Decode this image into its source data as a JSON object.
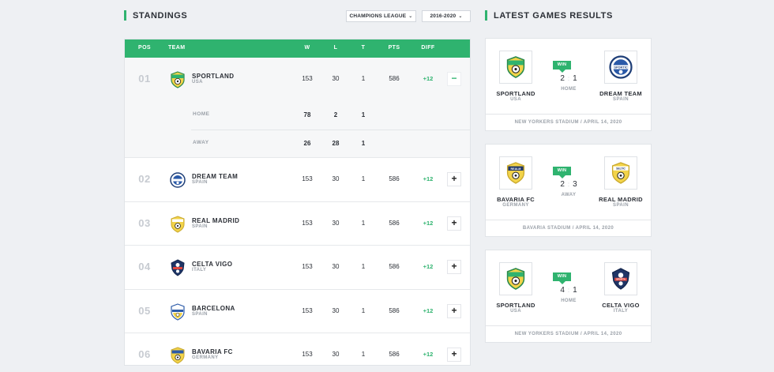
{
  "standings": {
    "title": "STANDINGS",
    "league_select": "CHAMPIONS LEAGUE",
    "season_select": "2016-2020",
    "headers": {
      "pos": "POS",
      "team": "TEAM",
      "w": "W",
      "l": "L",
      "t": "T",
      "pts": "PTS",
      "diff": "DIFF"
    },
    "rows": [
      {
        "pos": "01",
        "team": "SPORTLAND",
        "country": "USA",
        "w": "153",
        "l": "30",
        "t": "1",
        "pts": "586",
        "diff": "+12",
        "toggle": "−",
        "logo": "shield-green",
        "home": {
          "label": "HOME",
          "w": "78",
          "l": "2",
          "t": "1"
        },
        "away": {
          "label": "AWAY",
          "w": "26",
          "l": "28",
          "t": "1"
        }
      },
      {
        "pos": "02",
        "team": "DREAM TEAM",
        "country": "SPAIN",
        "w": "153",
        "l": "30",
        "t": "1",
        "pts": "586",
        "diff": "+12",
        "toggle": "+",
        "logo": "round-blue"
      },
      {
        "pos": "03",
        "team": "REAL MADRID",
        "country": "SPAIN",
        "w": "153",
        "l": "30",
        "t": "1",
        "pts": "586",
        "diff": "+12",
        "toggle": "+",
        "logo": "shield-yellow"
      },
      {
        "pos": "04",
        "team": "CELTA VIGO",
        "country": "ITALY",
        "w": "153",
        "l": "30",
        "t": "1",
        "pts": "586",
        "diff": "+12",
        "toggle": "+",
        "logo": "shield-navy"
      },
      {
        "pos": "05",
        "team": "BARCELONA",
        "country": "SPAIN",
        "w": "153",
        "l": "30",
        "t": "1",
        "pts": "586",
        "diff": "+12",
        "toggle": "+",
        "logo": "shield-blue-yellow"
      },
      {
        "pos": "06",
        "team": "BAVARIA FC",
        "country": "GERMANY",
        "w": "153",
        "l": "30",
        "t": "1",
        "pts": "586",
        "diff": "+12",
        "toggle": "+",
        "logo": "shield-blue-yellow-2"
      }
    ]
  },
  "latest": {
    "title": "LATEST GAMES RESULTS",
    "games": [
      {
        "home_team": "SPORTLAND",
        "home_country": "USA",
        "away_team": "DREAM TEAM",
        "away_country": "SPAIN",
        "badge": "WIN",
        "score_home": "2",
        "score_away": "1",
        "venue": "HOME",
        "stadium": "NEW YORKERS STADIUM / APRIL 14, 2020",
        "home_logo": "shield-green",
        "away_logo": "round-blue",
        "away_logo_text": "SPORTIC"
      },
      {
        "home_team": "BAVARIA FC",
        "home_country": "GERMANY",
        "away_team": "REAL MADRID",
        "away_country": "SPAIN",
        "badge": "WIN",
        "score_home": "2",
        "score_away": "3",
        "venue": "AWAY",
        "stadium": "BAVARIA STADIUM / APRIL 14, 2020",
        "home_logo": "shield-blue-yellow",
        "home_logo_text": "REALM",
        "away_logo": "shield-yellow",
        "away_logo_text": "SELTIC"
      },
      {
        "home_team": "SPORTLAND",
        "home_country": "USA",
        "away_team": "CELTA VIGO",
        "away_country": "ITALY",
        "badge": "WIN",
        "score_home": "4",
        "score_away": "1",
        "venue": "HOME",
        "stadium": "NEW YORKERS STADIUM / APRIL 14, 2020",
        "home_logo": "shield-green",
        "away_logo": "shield-navy",
        "away_logo_text": "SPARTA"
      }
    ]
  },
  "colors": {
    "accent": "#2fb36f",
    "text": "#2b2f36",
    "muted": "#9aa0a8"
  }
}
